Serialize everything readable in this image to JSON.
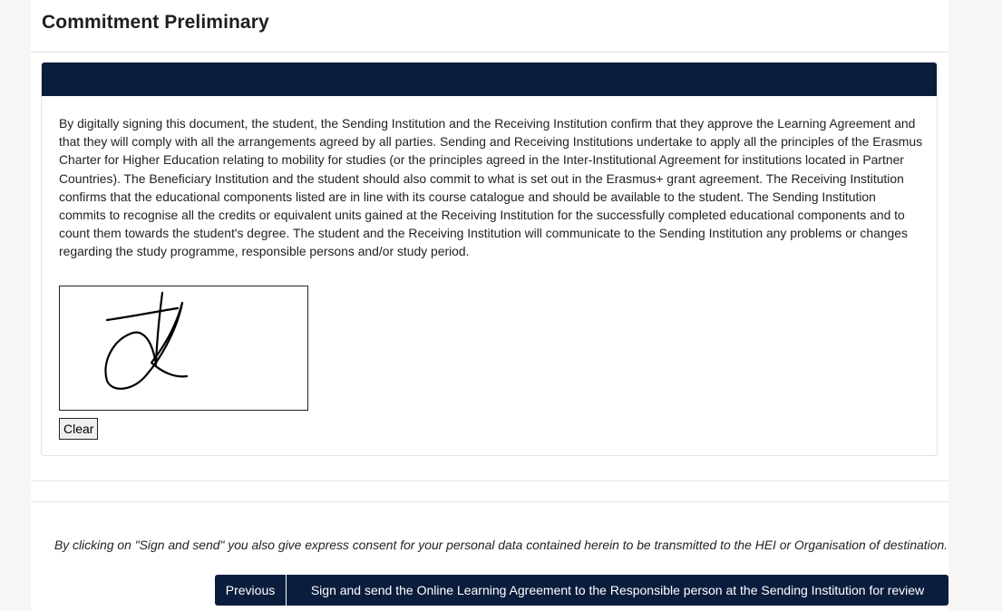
{
  "section": {
    "title": "Commitment Preliminary"
  },
  "commitment": {
    "text": "By digitally signing this document, the student, the Sending Institution and the Receiving Institution confirm that they approve the Learning Agreement and that they will comply with all the arrangements agreed by all parties. Sending and Receiving Institutions undertake to apply all the principles of the Erasmus Charter for Higher Education relating to mobility for studies (or the principles agreed in the Inter-Institutional Agreement for institutions located in Partner Countries). The Beneficiary Institution and the student should also commit to what is set out in the Erasmus+ grant agreement. The Receiving Institution confirms that the educational components listed are in line with its course catalogue and should be available to the student. The Sending Institution commits to recognise all the credits or equivalent units gained at the Receiving Institution for the successfully completed educational components and to count them towards the student's degree. The student and the Receiving Institution will communicate to the Sending Institution any problems or changes regarding the study programme, responsible persons and/or study period."
  },
  "signature": {
    "clear_label": "Clear"
  },
  "footer": {
    "consent_text": "By clicking on \"Sign and send\" you also give express consent for your personal data contained herein to be transmitted to the HEI or Organisation of destination.",
    "previous_label": "Previous",
    "sign_label": "Sign and send the Online Learning Agreement to the Responsible person at the Sending Institution for review"
  },
  "colors": {
    "navy": "#0b1d3d",
    "text": "#222222",
    "border": "#e3e3e3"
  }
}
